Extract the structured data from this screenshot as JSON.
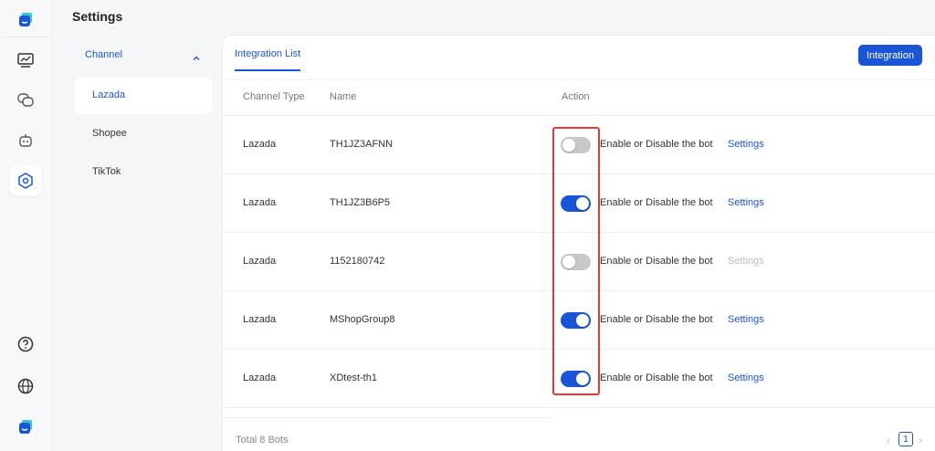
{
  "app": {
    "title": "Settings",
    "brand_color": "#1a55d6"
  },
  "rail": {
    "icons": [
      "app-logo-icon",
      "dashboard-icon",
      "chat-icon",
      "bot-icon",
      "integration-icon",
      "help-icon",
      "language-icon",
      "user-avatar-icon"
    ],
    "active": "integration-icon"
  },
  "subnav": {
    "group_label": "Channel",
    "items": [
      {
        "label": "Lazada",
        "active": true
      },
      {
        "label": "Shopee",
        "active": false
      },
      {
        "label": "TikTok",
        "active": false
      }
    ]
  },
  "main": {
    "tab_label": "Integration List",
    "primary_button": "Integration",
    "columns": {
      "channel_type": "Channel Type",
      "name": "Name",
      "action": "Action"
    },
    "toggle_label": "Enable or Disable the bot",
    "settings_label": "Settings",
    "rows": [
      {
        "channel": "Lazada",
        "name": "TH1JZ3AFNN",
        "enabled": false,
        "settings_enabled": true
      },
      {
        "channel": "Lazada",
        "name": "TH1JZ3B6P5",
        "enabled": true,
        "settings_enabled": true
      },
      {
        "channel": "Lazada",
        "name": "1152180742",
        "enabled": false,
        "settings_enabled": false
      },
      {
        "channel": "Lazada",
        "name": "MShopGroup8",
        "enabled": true,
        "settings_enabled": true
      },
      {
        "channel": "Lazada",
        "name": "XDtest-th1",
        "enabled": true,
        "settings_enabled": true
      }
    ],
    "footer": {
      "total_text": "Total 8 Bots",
      "current_page": "1"
    }
  }
}
